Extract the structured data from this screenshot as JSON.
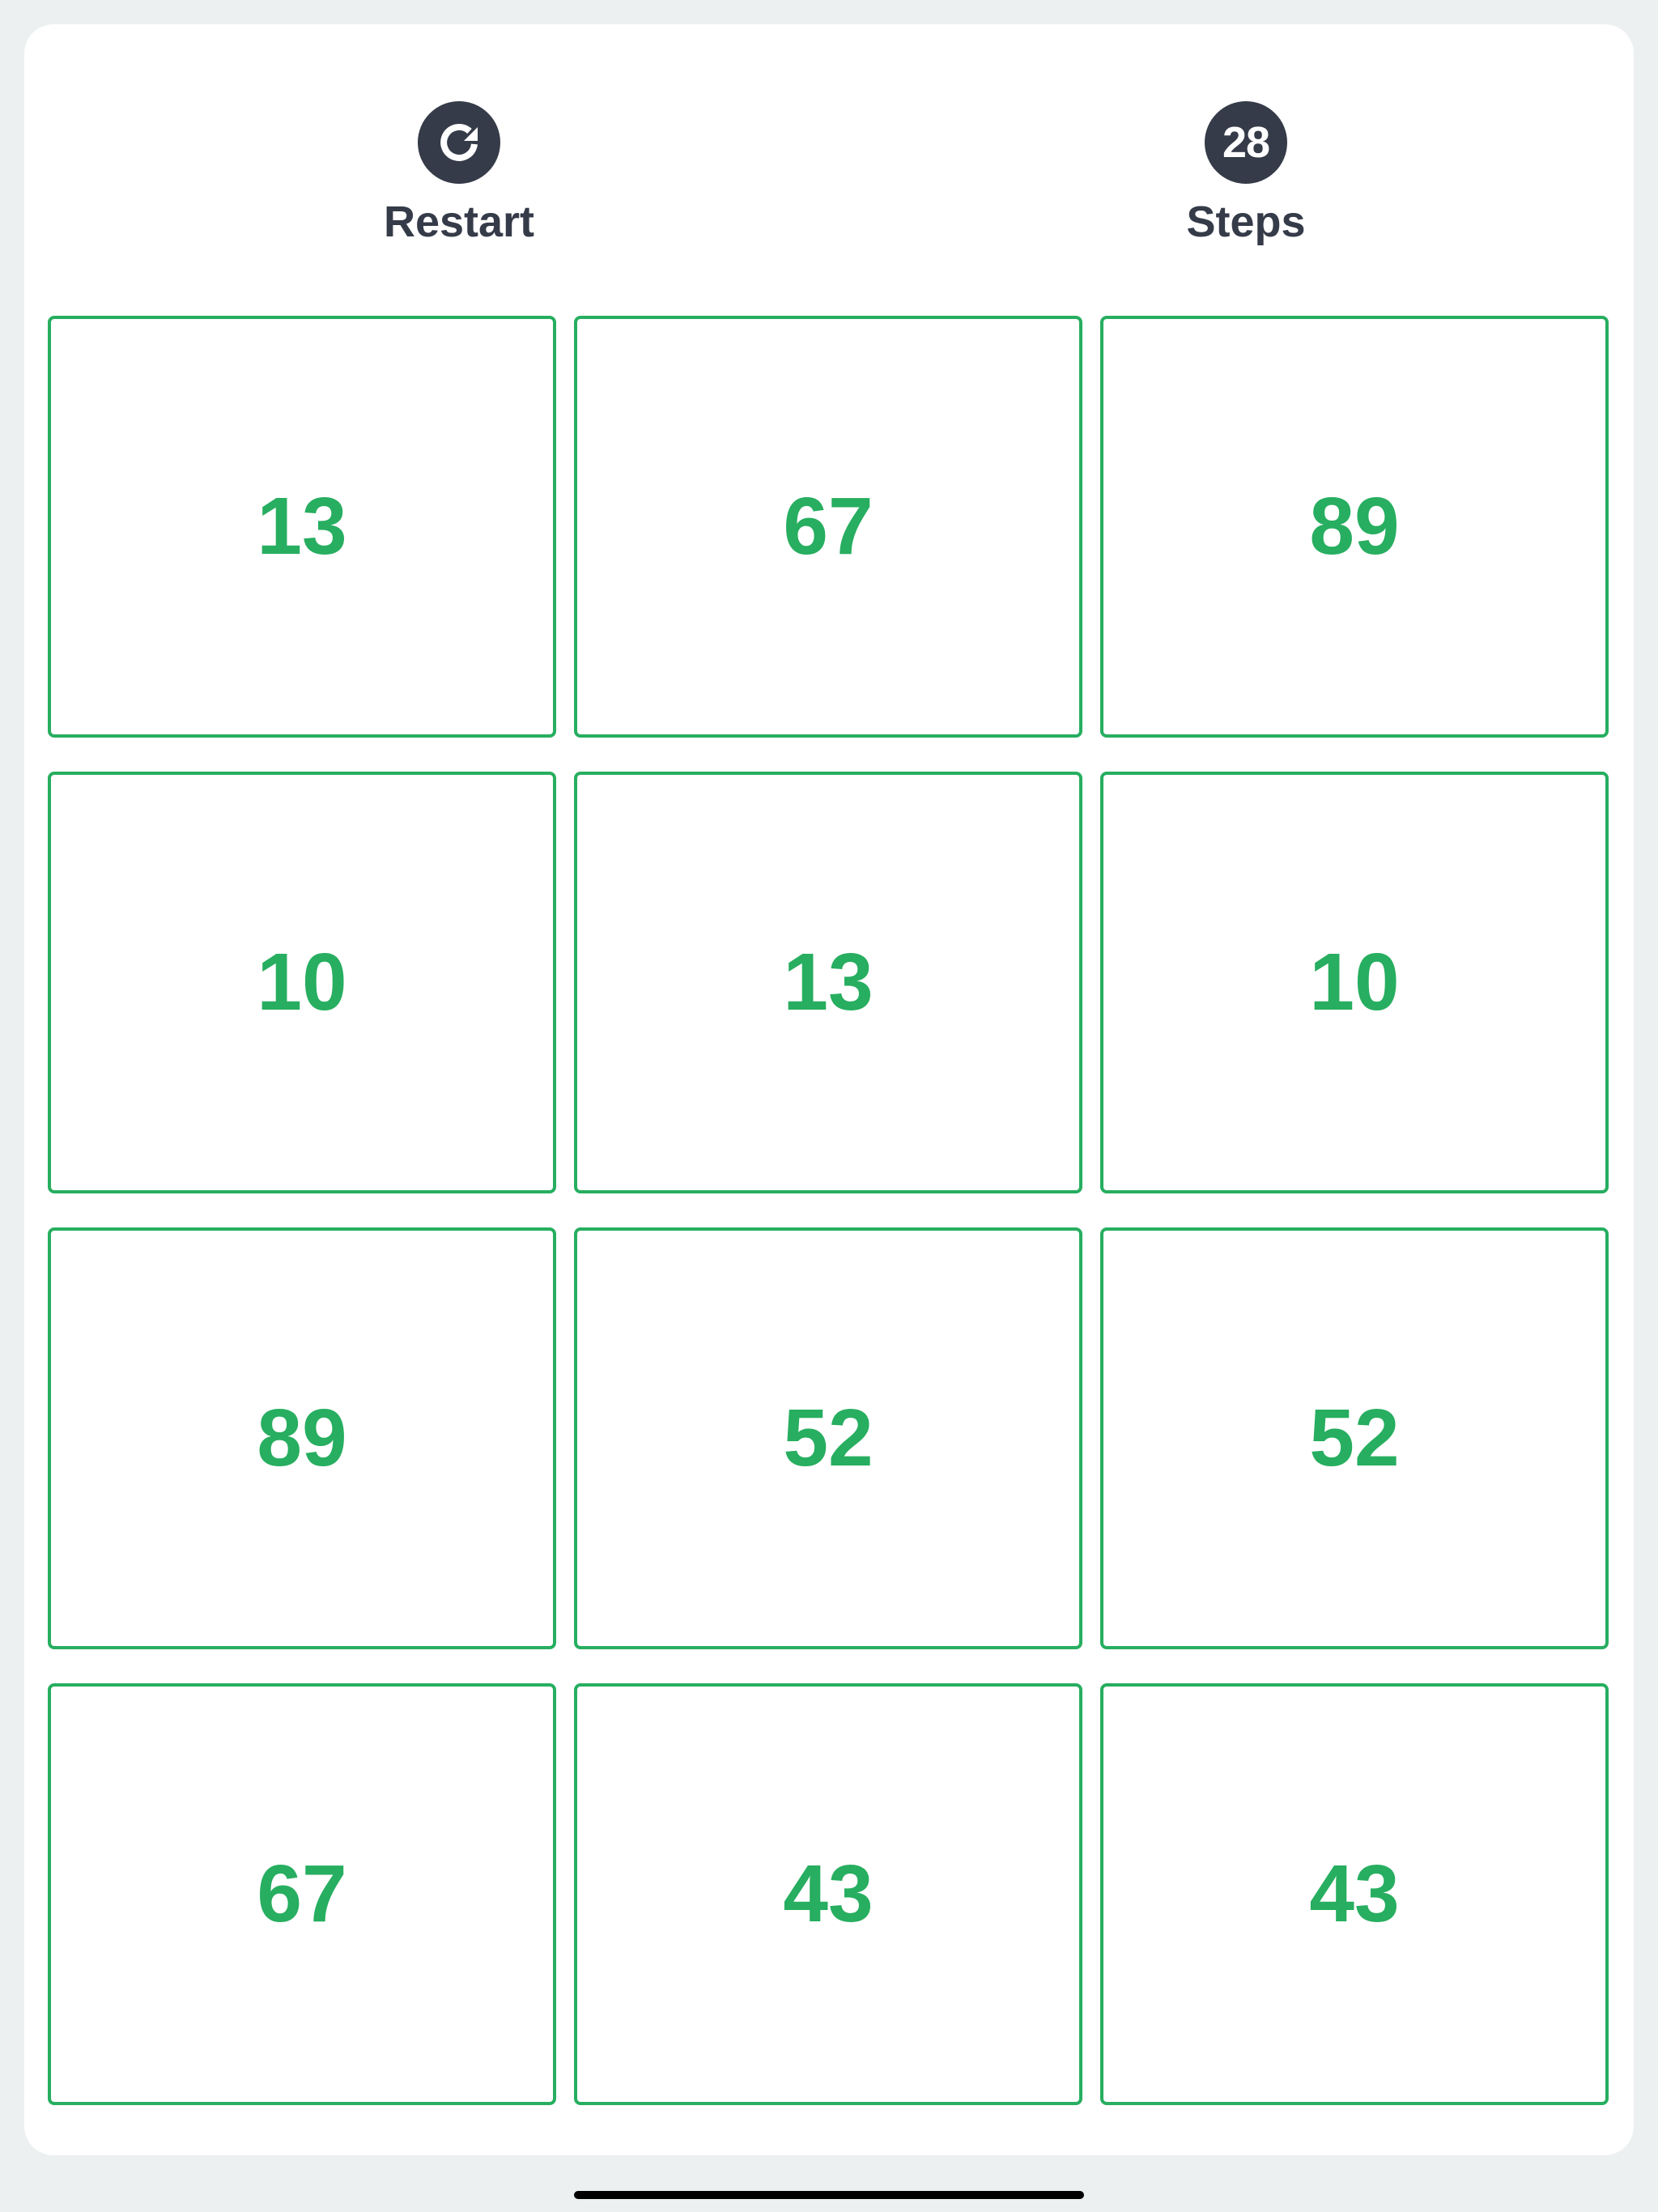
{
  "header": {
    "restart_label": "Restart",
    "steps_label": "Steps",
    "steps_count": "28"
  },
  "tiles": [
    "13",
    "67",
    "89",
    "10",
    "13",
    "10",
    "89",
    "52",
    "52",
    "67",
    "43",
    "43"
  ],
  "colors": {
    "tile_accent": "#27ae60",
    "dark": "#353b48",
    "background": "#ecf0f1",
    "panel": "#ffffff"
  },
  "icons": {
    "restart": "restart-icon"
  }
}
